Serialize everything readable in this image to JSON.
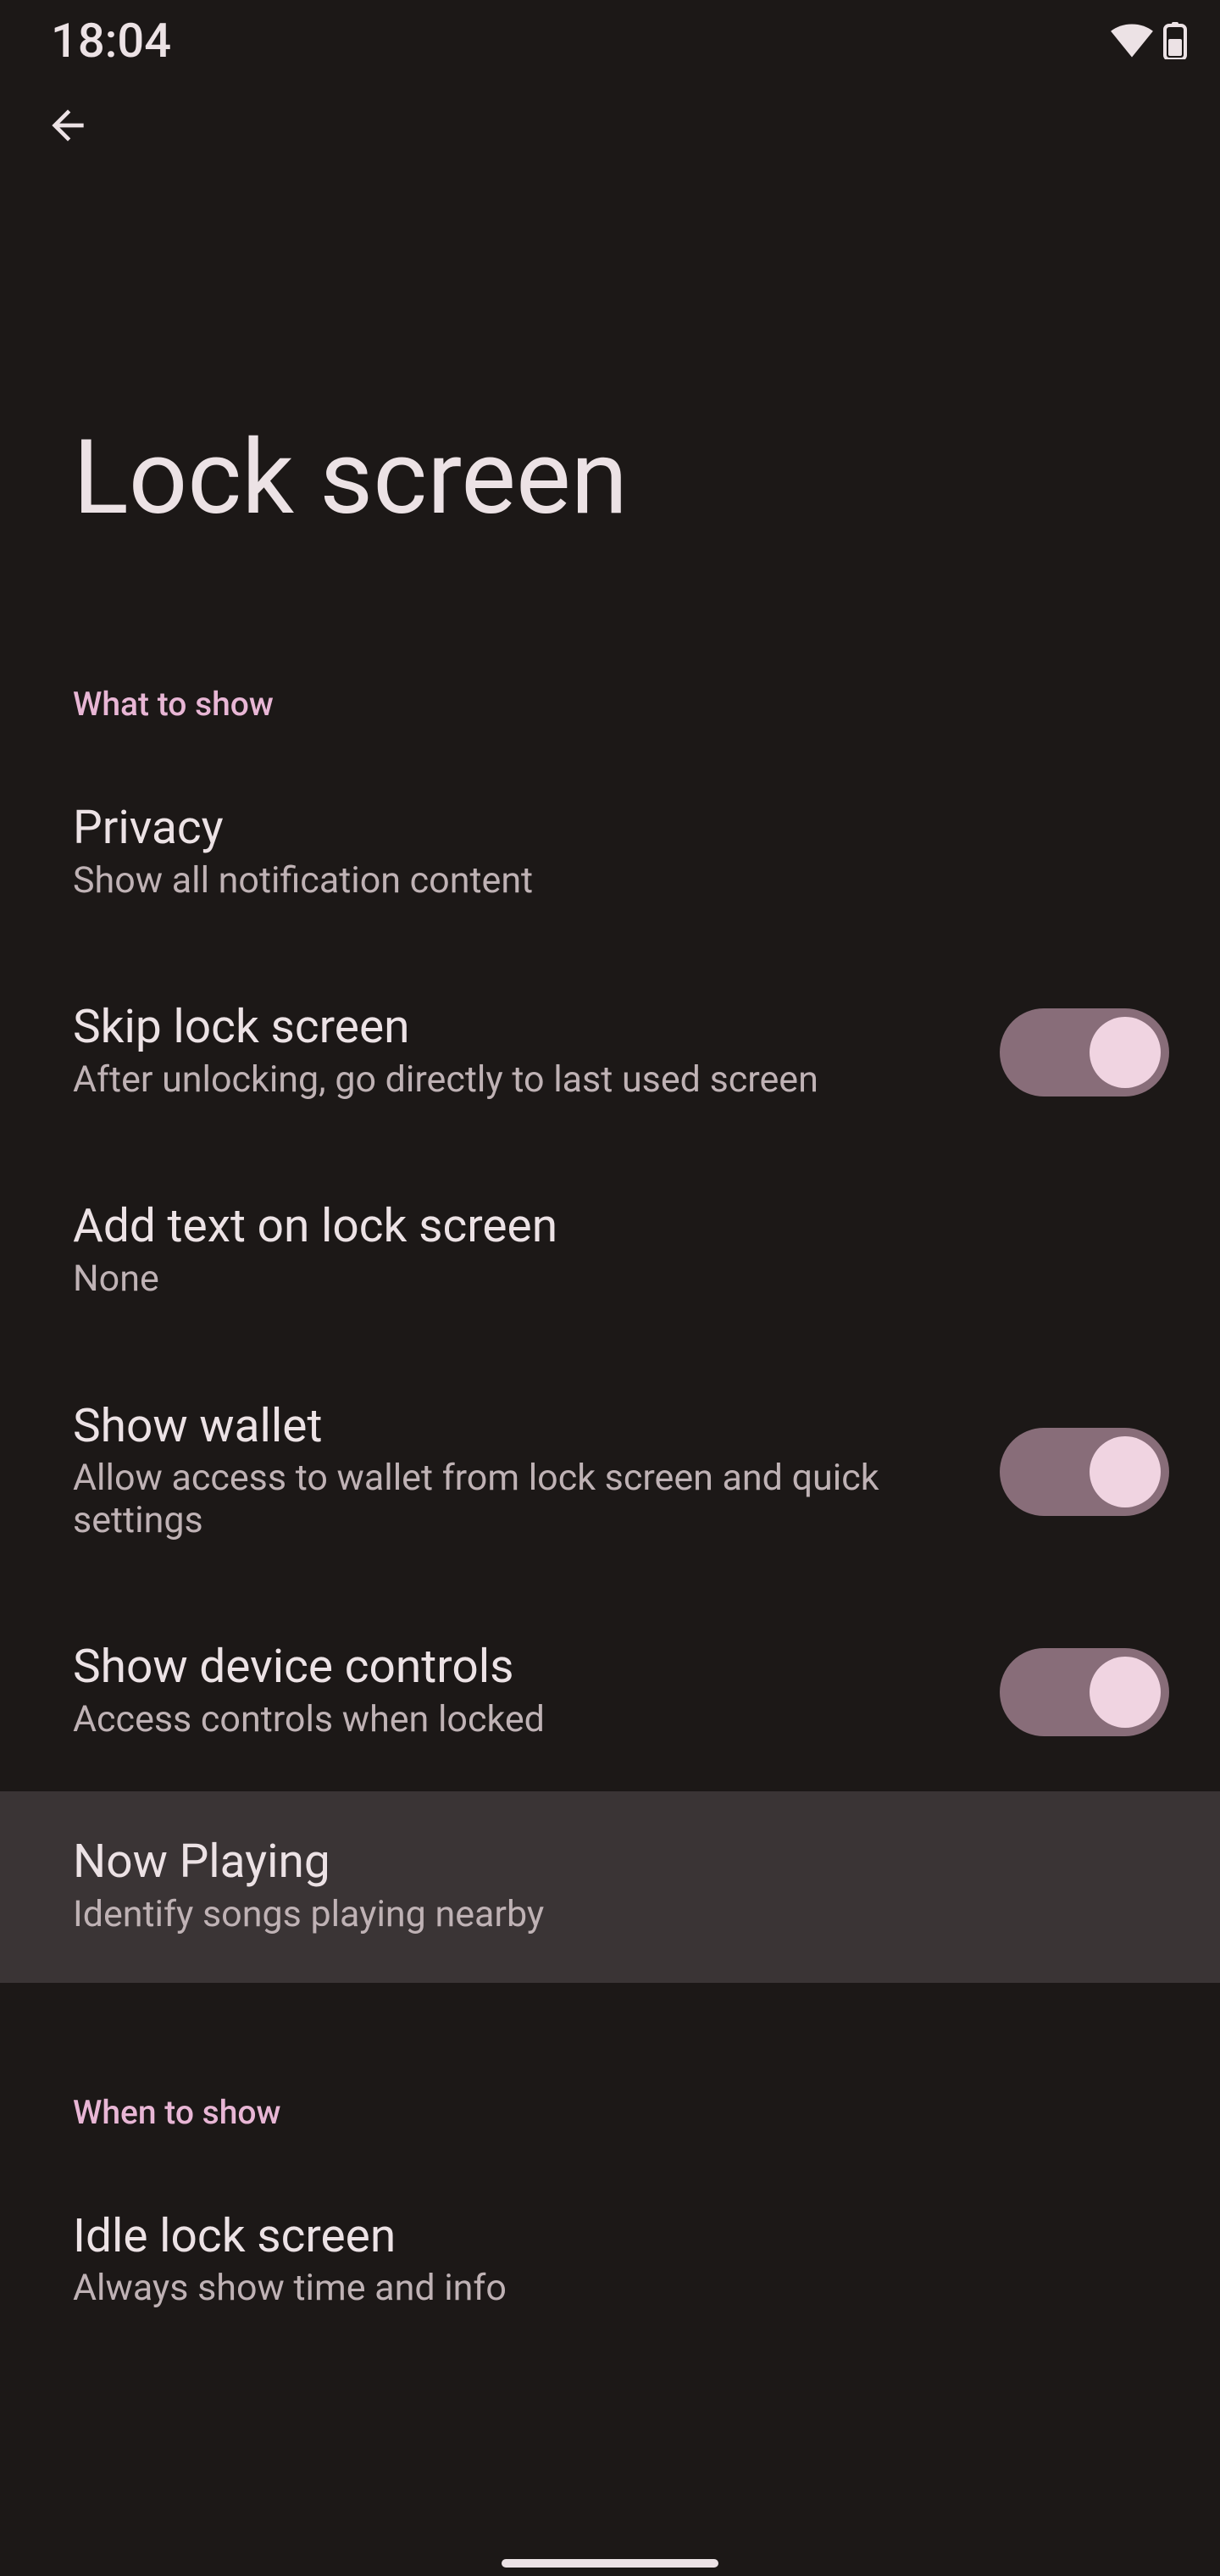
{
  "statusbar": {
    "time": "18:04"
  },
  "page": {
    "title": "Lock screen"
  },
  "sections": {
    "what_to_show": {
      "header": "What to show",
      "privacy": {
        "title": "Privacy",
        "summary": "Show all notification content"
      },
      "skip": {
        "title": "Skip lock screen",
        "summary": "After unlocking, go directly to last used screen"
      },
      "add_text": {
        "title": "Add text on lock screen",
        "summary": "None"
      },
      "wallet": {
        "title": "Show wallet",
        "summary": "Allow access to wallet from lock screen and quick settings"
      },
      "device_controls": {
        "title": "Show device controls",
        "summary": "Access controls when locked"
      },
      "now_playing": {
        "title": "Now Playing",
        "summary": "Identify songs playing nearby"
      }
    },
    "when_to_show": {
      "header": "When to show",
      "idle": {
        "title": "Idle lock screen",
        "summary": "Always show time and info"
      }
    }
  }
}
